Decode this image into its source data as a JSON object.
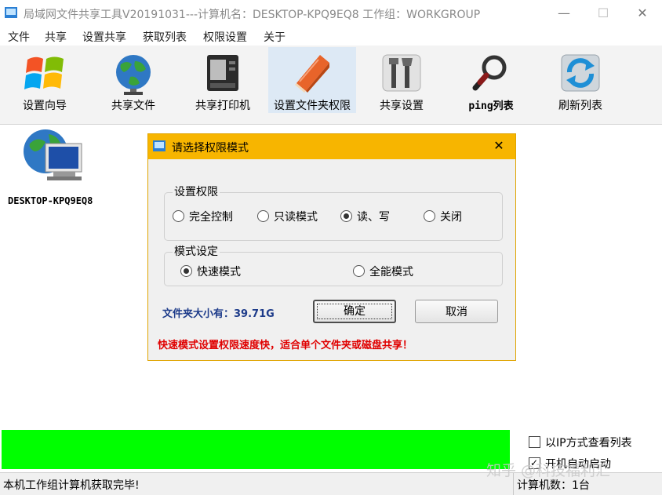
{
  "window": {
    "title": "局域网文件共享工具V20191031---计算机名：DESKTOP-KPQ9EQ8  工作组：WORKGROUP",
    "minimize": "—",
    "maximize": "☐",
    "close": "✕"
  },
  "menu": [
    "文件",
    "共享",
    "设置共享",
    "获取列表",
    "权限设置",
    "关于"
  ],
  "toolbar": [
    {
      "label": "设置向导",
      "icon": "windows-logo-icon"
    },
    {
      "label": "共享文件",
      "icon": "globe-icon"
    },
    {
      "label": "共享打印机",
      "icon": "printer-icon"
    },
    {
      "label": "设置文件夹权限",
      "icon": "folder-book-icon"
    },
    {
      "label": "共享设置",
      "icon": "tools-icon"
    },
    {
      "label": "ping列表",
      "icon": "magnifier-icon"
    },
    {
      "label": "刷新列表",
      "icon": "refresh-icon"
    }
  ],
  "computer": {
    "name": "DESKTOP-KPQ9EQ8",
    "icon": "network-computer-icon"
  },
  "dialog": {
    "title": "请选择权限模式",
    "close": "✕",
    "permission_group": "设置权限",
    "permission_options": [
      "完全控制",
      "只读模式",
      "读、写",
      "关闭"
    ],
    "permission_selected": 2,
    "mode_group": "模式设定",
    "mode_options": [
      "快速模式",
      "全能模式"
    ],
    "mode_selected": 0,
    "folder_size": "文件夹大小有：39.71G",
    "ok": "确定",
    "cancel": "取消",
    "tip": "快速模式设置权限速度快，适合单个文件夹或磁盘共享！"
  },
  "progress": {
    "percent": 100,
    "color": "#00ff00"
  },
  "options": {
    "ip_view_label": "以IP方式查看列表",
    "ip_view_checked": false,
    "second_label": "开机自动启动",
    "second_checked": true
  },
  "status": {
    "message": "本机工作组计算机获取完毕!",
    "count": "计算机数：1台"
  },
  "watermark": "知乎 @科技福利汇"
}
